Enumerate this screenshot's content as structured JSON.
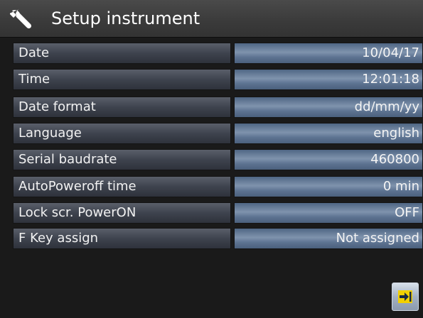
{
  "header": {
    "title": "Setup instrument",
    "icon": "wrench-icon"
  },
  "settings": [
    {
      "label": "Date",
      "value": "10/04/17"
    },
    {
      "label": "Time",
      "value": "12:01:18"
    },
    {
      "label": "Date format",
      "value": "dd/mm/yy"
    },
    {
      "label": "Language",
      "value": "english"
    },
    {
      "label": "Serial baudrate",
      "value": "460800"
    },
    {
      "label": "AutoPoweroff time",
      "value": "0 min"
    },
    {
      "label": "Lock scr. PowerON",
      "value": "OFF"
    },
    {
      "label": "F Key assign",
      "value": "Not assigned"
    }
  ],
  "footer": {
    "exit_icon": "exit-arrow-icon"
  },
  "colors": {
    "exit_icon_color": "#f2d000",
    "background": "#1a1a1a"
  }
}
